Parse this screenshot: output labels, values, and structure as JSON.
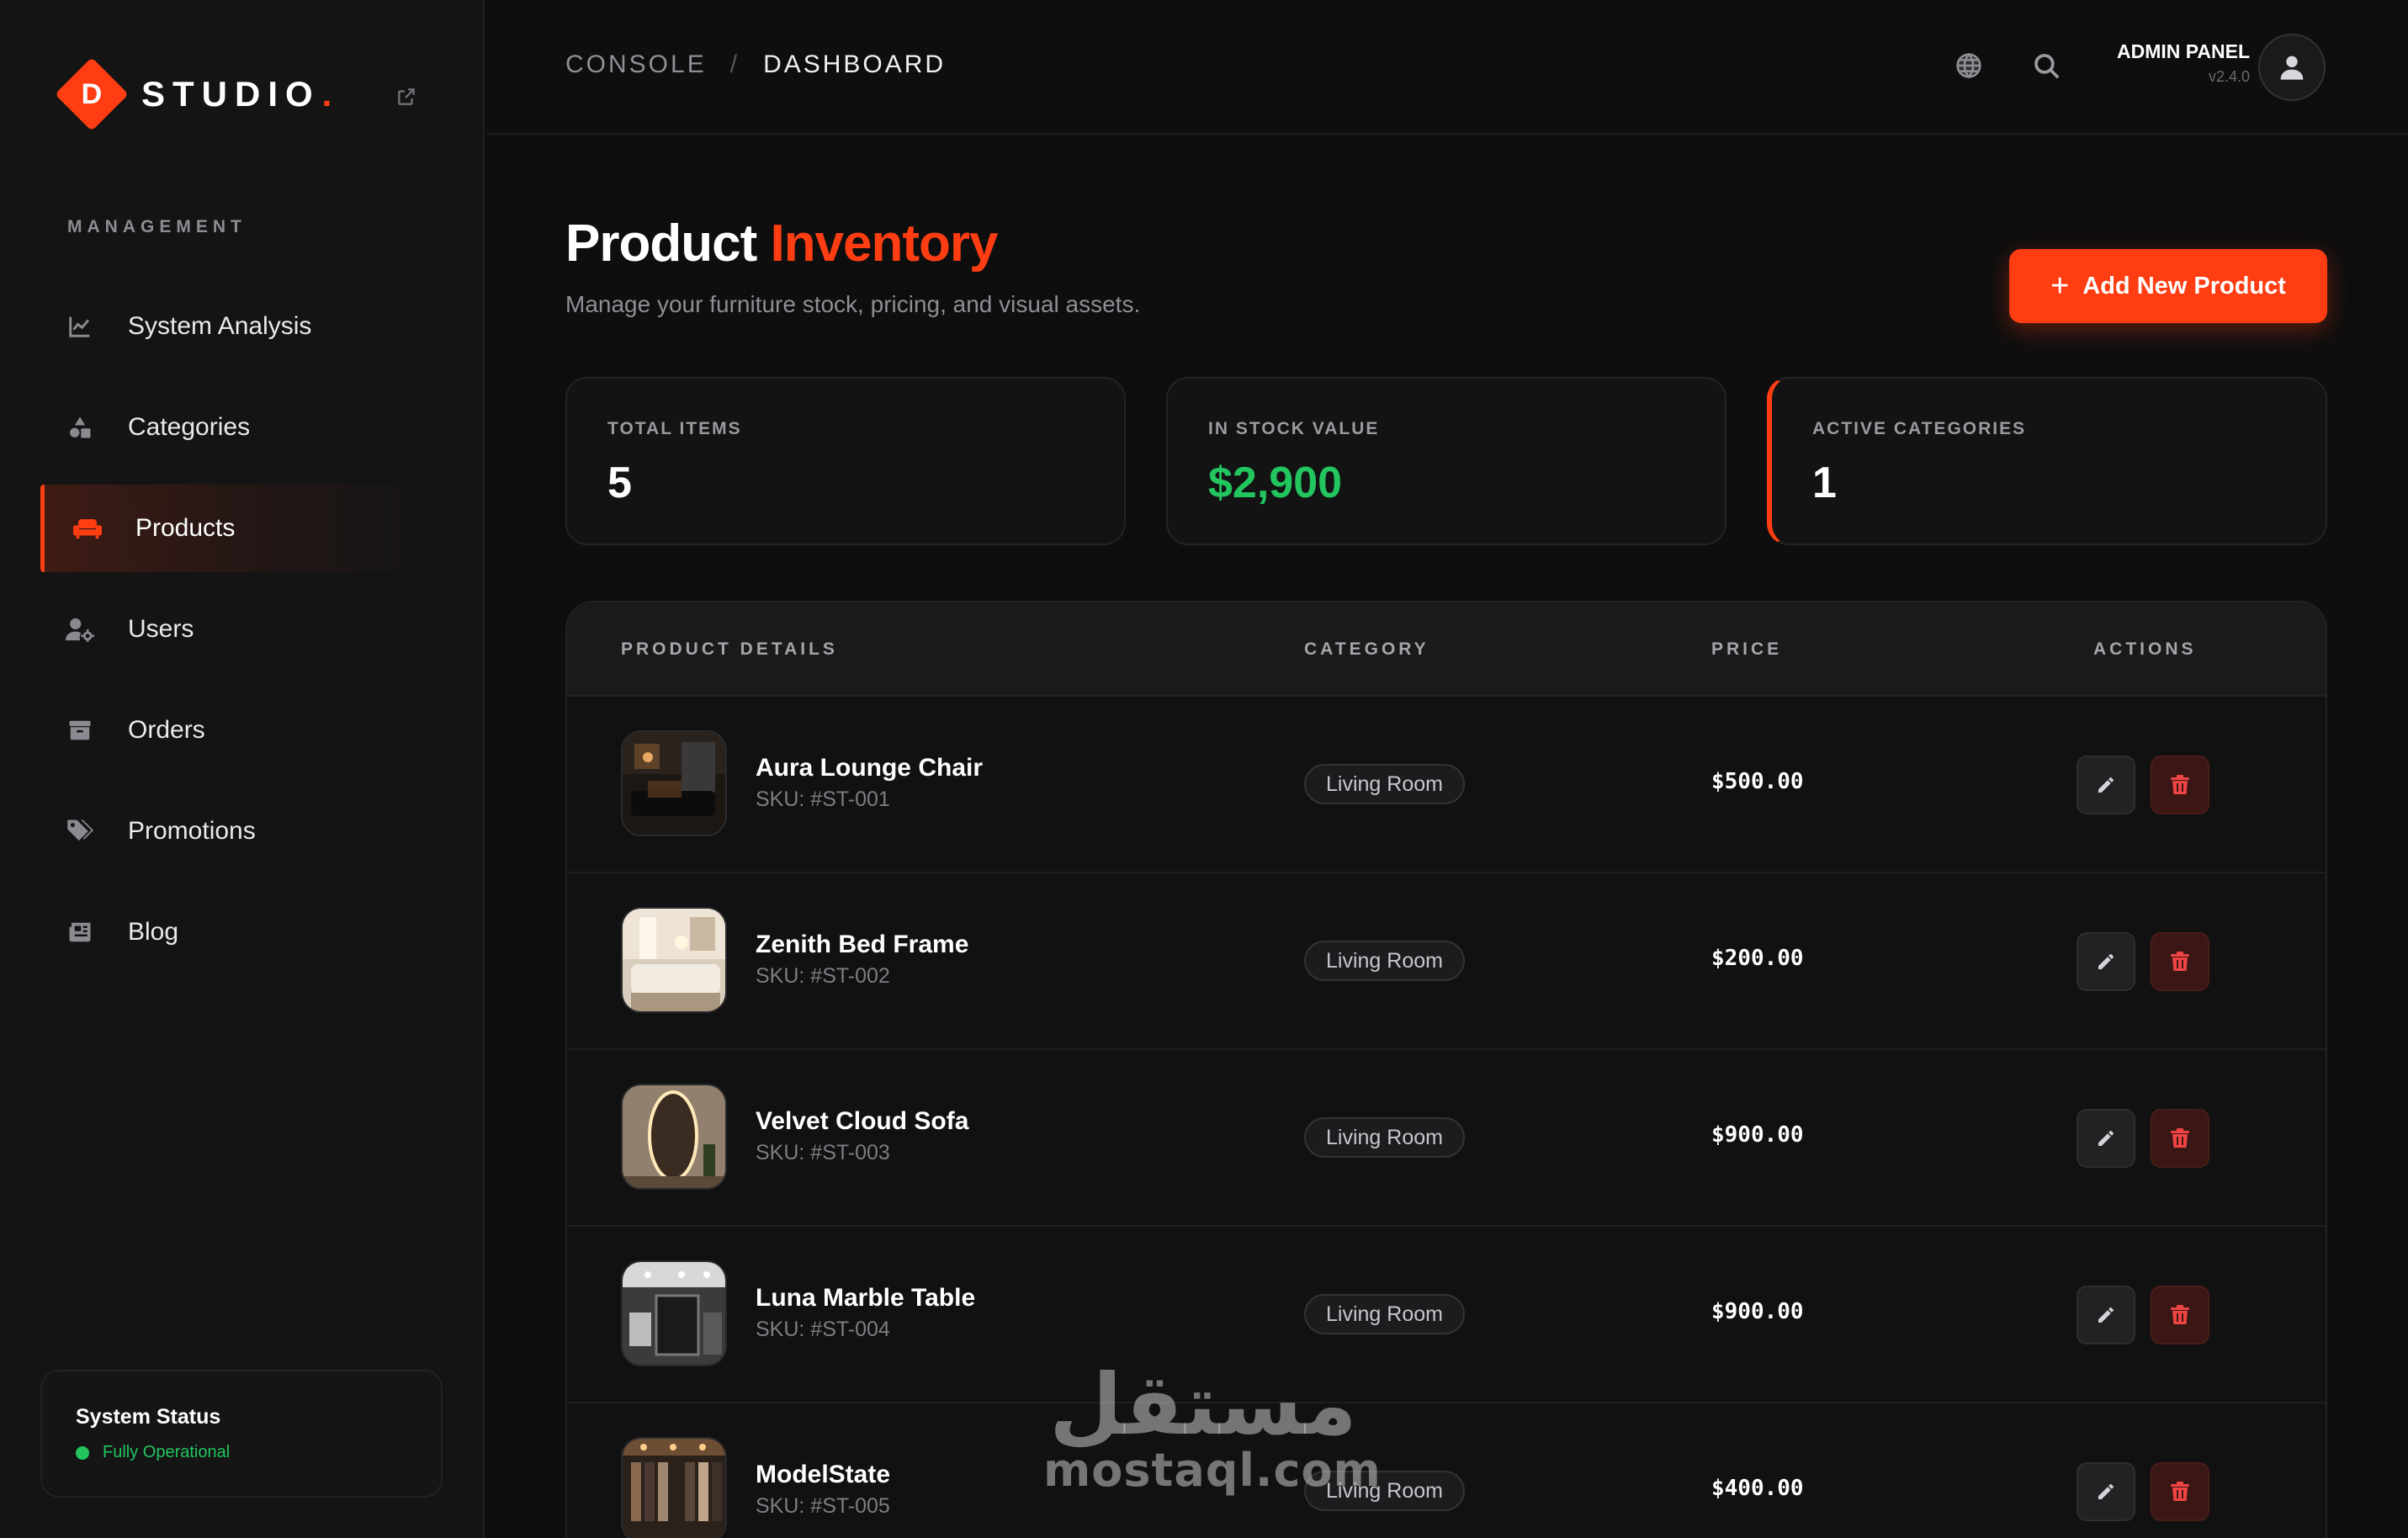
{
  "brand": {
    "letter": "D",
    "name": "STUDIO",
    "dot": ".",
    "accent": "#ff3d12"
  },
  "sidebar": {
    "section_label": "MANAGEMENT",
    "items": [
      {
        "label": "System Analysis",
        "icon": "chart-line-icon"
      },
      {
        "label": "Categories",
        "icon": "shapes-icon"
      },
      {
        "label": "Products",
        "icon": "couch-icon",
        "active": true
      },
      {
        "label": "Users",
        "icon": "users-gear-icon"
      },
      {
        "label": "Orders",
        "icon": "archive-box-icon"
      },
      {
        "label": "Promotions",
        "icon": "tags-icon"
      },
      {
        "label": "Blog",
        "icon": "newspaper-icon"
      }
    ],
    "status": {
      "title": "System Status",
      "text": "Fully Operational",
      "color": "#22c55e"
    }
  },
  "header": {
    "breadcrumb": [
      "CONSOLE",
      "DASHBOARD"
    ],
    "separator": "/",
    "admin_title": "ADMIN PANEL",
    "admin_version": "v2.4.0"
  },
  "main": {
    "title_plain": "Product",
    "title_accent": "Inventory",
    "subtitle": "Manage your furniture stock, pricing, and visual assets.",
    "add_button": "Add New Product",
    "add_button_icon": "+",
    "stats": [
      {
        "label": "TOTAL ITEMS",
        "value": "5"
      },
      {
        "label": "IN STOCK VALUE",
        "value": "$2,900",
        "color": "#22c55e"
      },
      {
        "label": "ACTIVE CATEGORIES",
        "value": "1"
      }
    ],
    "table": {
      "headers": [
        "PRODUCT DETAILS",
        "CATEGORY",
        "PRICE",
        "ACTIONS"
      ],
      "rows": [
        {
          "name": "Aura Lounge Chair",
          "sku": "SKU: #ST-001",
          "category": "Living Room",
          "price": "$500.00"
        },
        {
          "name": "Zenith Bed Frame",
          "sku": "SKU: #ST-002",
          "category": "Living Room",
          "price": "$200.00"
        },
        {
          "name": "Velvet Cloud Sofa",
          "sku": "SKU: #ST-003",
          "category": "Living Room",
          "price": "$900.00"
        },
        {
          "name": "Luna Marble Table",
          "sku": "SKU: #ST-004",
          "category": "Living Room",
          "price": "$900.00"
        },
        {
          "name": "ModelState",
          "sku": "SKU: #ST-005",
          "category": "Living Room",
          "price": "$400.00"
        }
      ]
    }
  },
  "watermark": {
    "arabic": "مستقل",
    "latin": "mostaql.com"
  }
}
